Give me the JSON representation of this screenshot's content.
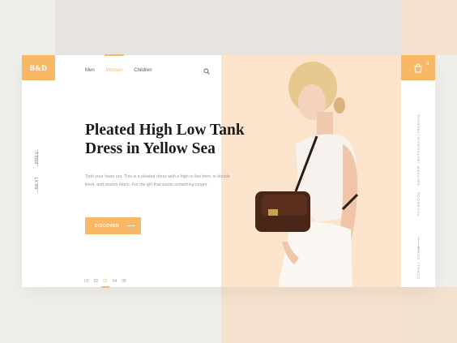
{
  "brand": {
    "logo": "B&D"
  },
  "cart": {
    "count": "0"
  },
  "nav": {
    "items": [
      "Men",
      "Women",
      "Children"
    ],
    "active": "Women"
  },
  "hero": {
    "title_line1": "Pleated High Low Tank",
    "title_line2": "Dress in Yellow Sea",
    "description": "Twirl your heart out. This is a pleated dress with a high to low hem, is double lined, and stretch fabric. For the girl that wants something longer.",
    "cta": "DISCOVER"
  },
  "slider_controls": {
    "prev": "PREV",
    "next": "NEXT"
  },
  "pager": {
    "pages": [
      "01",
      "02",
      "03",
      "04",
      "05"
    ],
    "active_index": 2
  },
  "social": {
    "items": [
      "LINKEDIN",
      "INSTAGRAM",
      "TWITTER",
      "FACEBOOK"
    ]
  },
  "scroll": {
    "label": "SCROLL DOWN"
  },
  "colors": {
    "accent": "#f9b866",
    "peach": "#fbe3cc",
    "text": "#1b1b1b"
  }
}
